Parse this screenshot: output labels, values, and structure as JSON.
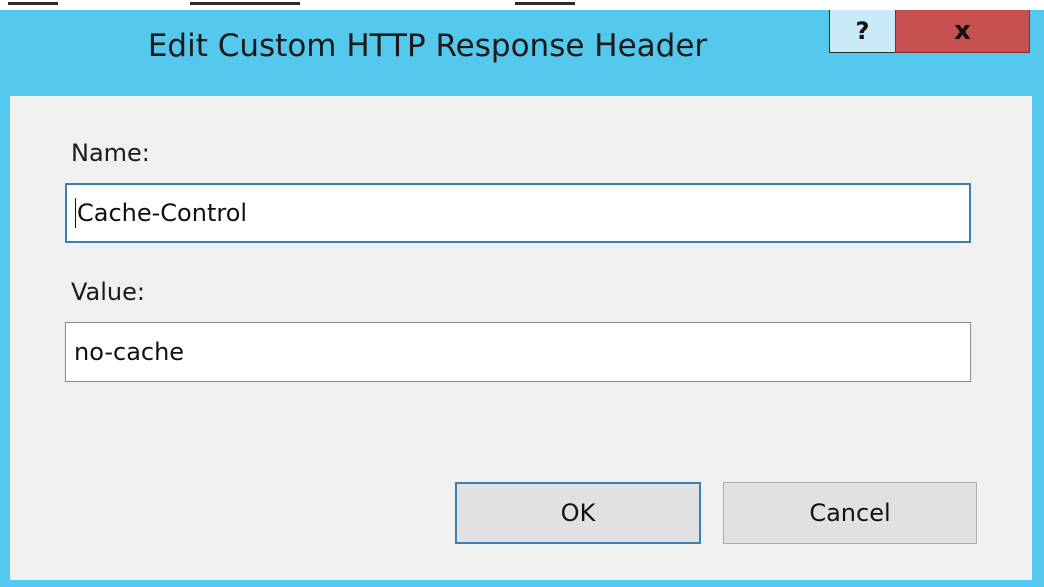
{
  "dialog": {
    "title": "Edit Custom HTTP Response Header",
    "help_glyph": "?",
    "close_glyph": "x"
  },
  "form": {
    "name_label": "Name:",
    "name_value": "Cache-Control",
    "value_label": "Value:",
    "value_value": "no-cache"
  },
  "buttons": {
    "ok_label": "OK",
    "cancel_label": "Cancel"
  },
  "colors": {
    "title_bar": "#55c8ee",
    "close_button": "#c75050",
    "client_area": "#f0f0f0",
    "focus_border": "#3c7fb1"
  }
}
